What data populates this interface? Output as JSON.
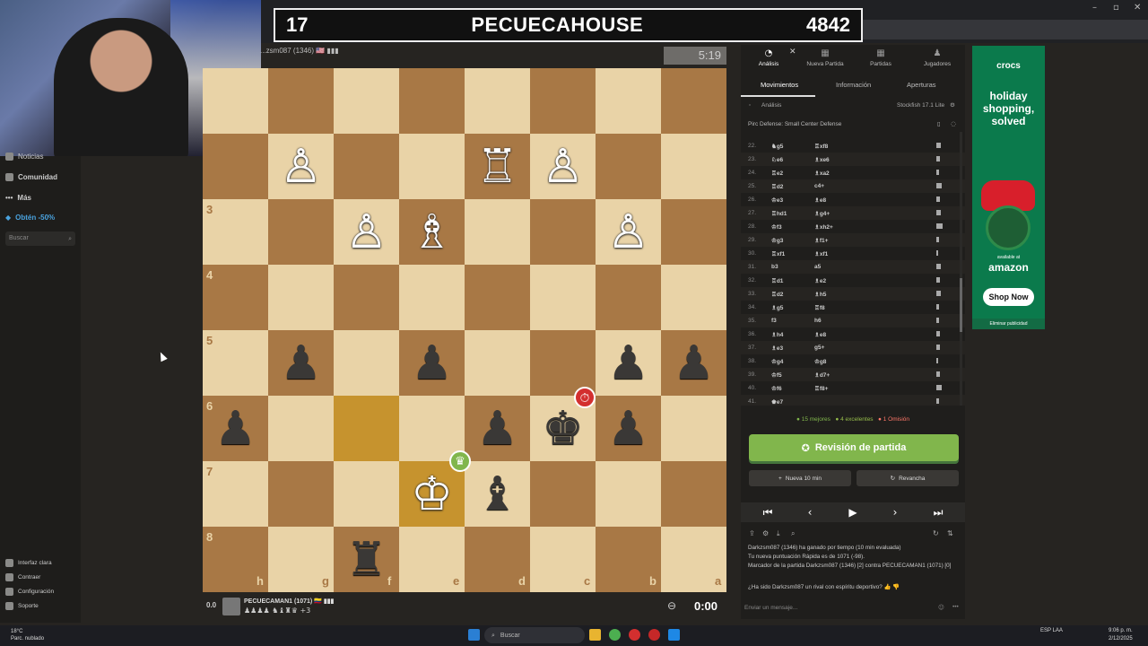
{
  "banner": {
    "left_score": "17",
    "title": "PECUECAHOUSE",
    "right_score": "4842"
  },
  "top_player": {
    "name": "...zsm087 (1346) 🇺🇸 ▮▮▮",
    "clock": "5:19"
  },
  "bottom_player": {
    "eval": "0.0",
    "name": "PECUECAMAN1 (1071) 🇨🇴 ▮▮▮",
    "captured": "♟♟♟♟ ♞♝♜♛ +3",
    "clock": "0:00"
  },
  "sidebar": {
    "items": [
      {
        "label": "Noticias"
      },
      {
        "label": "Comunidad"
      },
      {
        "label": "Más"
      },
      {
        "label": "Obtén -50%"
      }
    ],
    "search_placeholder": "Buscar",
    "bottom_items": [
      {
        "label": "Interfaz clara"
      },
      {
        "label": "Contraer"
      },
      {
        "label": "Configuración"
      },
      {
        "label": "Soporte"
      }
    ]
  },
  "board": {
    "rank_labels": [
      "3",
      "4",
      "5",
      "6",
      "7",
      "8"
    ],
    "file_labels": [
      "h",
      "g",
      "f",
      "e",
      "d",
      "c",
      "b",
      "a"
    ],
    "highlight_color": "#c6932e"
  },
  "panel": {
    "nav": [
      {
        "icon": "◔",
        "label": "Análisis"
      },
      {
        "icon": "▦",
        "label": "Nueva Partida"
      },
      {
        "icon": "▦",
        "label": "Partidas"
      },
      {
        "icon": "♟",
        "label": "Jugadores"
      }
    ],
    "subtabs": [
      "Movimientos",
      "Información",
      "Aperturas"
    ],
    "analysis_label": "Análisis",
    "engine_label": "Stockfish 17.1 Lite",
    "opening": "Pirc Defense: Small Center Defense",
    "moves": [
      {
        "n": "22.",
        "w": "♞g5",
        "b": "♖xf8"
      },
      {
        "n": "23.",
        "w": "♘e6",
        "b": "♗xe6"
      },
      {
        "n": "24.",
        "w": "♖e2",
        "b": "♗xa2"
      },
      {
        "n": "25.",
        "w": "♖d2",
        "b": "c4+"
      },
      {
        "n": "26.",
        "w": "♔e3",
        "b": "♗e8"
      },
      {
        "n": "27.",
        "w": "♖hd1",
        "b": "♗g4+"
      },
      {
        "n": "28.",
        "w": "♔f3",
        "b": "♗xh2+"
      },
      {
        "n": "29.",
        "w": "♔g3",
        "b": "♗f1+"
      },
      {
        "n": "30.",
        "w": "♖xf1",
        "b": "♗xf1"
      },
      {
        "n": "31.",
        "w": "b3",
        "b": "a5"
      },
      {
        "n": "32.",
        "w": "♖d1",
        "b": "♗e2"
      },
      {
        "n": "33.",
        "w": "♖d2",
        "b": "♗h5"
      },
      {
        "n": "34.",
        "w": "♗g5",
        "b": "♖f8"
      },
      {
        "n": "35.",
        "w": "f3",
        "b": "h6"
      },
      {
        "n": "36.",
        "w": "♗h4",
        "b": "♗e8"
      },
      {
        "n": "37.",
        "w": "♗e3",
        "b": "g5+"
      },
      {
        "n": "38.",
        "w": "♔g4",
        "b": "♔g8"
      },
      {
        "n": "39.",
        "w": "♔f5",
        "b": "♗d7+"
      },
      {
        "n": "40.",
        "w": "♔f6",
        "b": "♖f8+"
      },
      {
        "n": "41.",
        "w": "♚e7",
        "b": ""
      }
    ],
    "stats": {
      "best": "15 mejores",
      "excellent": "4 excelentes",
      "miss": "1 Omisión"
    },
    "review_button": "Revisión de partida",
    "new_game_button": "Nueva 10 min",
    "rematch_button": "Revancha",
    "chat": [
      "Darkzsm087 (1346) ha ganado por tiempo (10 min evaluada)",
      "Tu nueva puntuación Rápida es de 1071 (-98).",
      "Marcador de la partida Darkzsm087 (1346) [2] contra PECUECAMAN1 (1071) [0]",
      "¿Ha sido Darkzsm087 un rival con espíritu deportivo?"
    ],
    "chat_placeholder": "Enviar un mensaje..."
  },
  "ad": {
    "brand": "crocs",
    "headline": "holiday shopping, solved",
    "available": "available at",
    "store": "amazon",
    "cta": "Shop Now",
    "remove": "Eliminar publicidad"
  },
  "taskbar": {
    "weather_temp": "18°C",
    "weather_desc": "Parc. nublado",
    "search": "Buscar",
    "lang": "ESP LAA",
    "time": "9:06 p. m.",
    "date": "2/12/2025"
  },
  "colors": {
    "accent": "#81b64c",
    "light_square": "#e9d3a7",
    "dark_square": "#a87845",
    "badge_red": "#d32f2f"
  }
}
